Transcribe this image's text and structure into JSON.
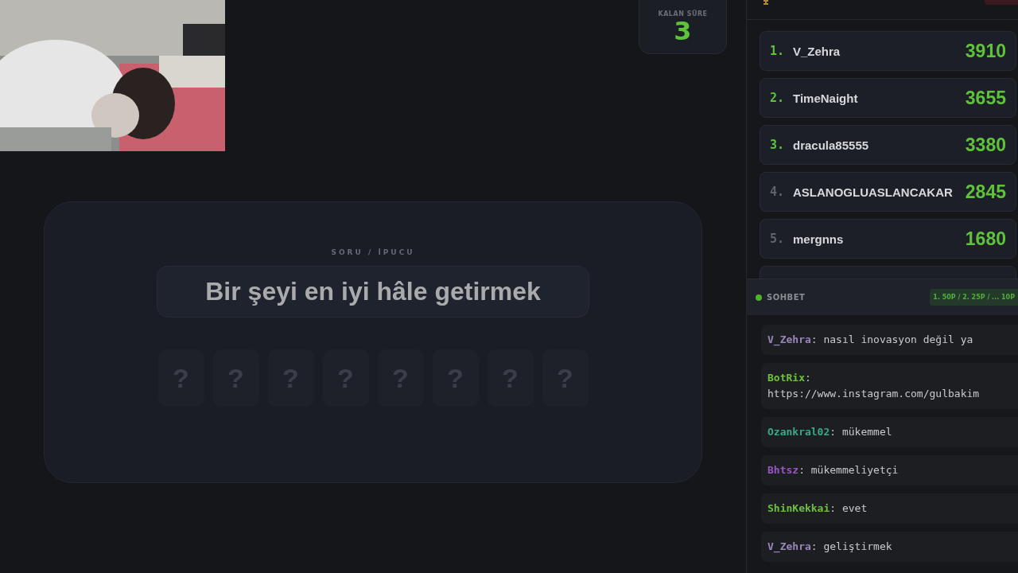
{
  "timer": {
    "label": "KALAN SÜRE",
    "value": "3"
  },
  "quiz": {
    "label": "SORU / İPUCU",
    "question": "Bir şeyi en iyi hâle getirmek",
    "tiles": [
      "?",
      "?",
      "?",
      "?",
      "?",
      "?",
      "?",
      "?"
    ]
  },
  "leaderboard": {
    "rows": [
      {
        "rank": "1.",
        "name": "V_Zehra",
        "score": "3910",
        "top": true
      },
      {
        "rank": "2.",
        "name": "TimeNaight",
        "score": "3655",
        "top": true
      },
      {
        "rank": "3.",
        "name": "dracula85555",
        "score": "3380",
        "top": true
      },
      {
        "rank": "4.",
        "name": "ASLANOGLUASLANCAKAR",
        "score": "2845",
        "top": false
      },
      {
        "rank": "5.",
        "name": "mergnns",
        "score": "1680",
        "top": false
      }
    ]
  },
  "chat": {
    "title": "SOHBET",
    "online": true,
    "rules": "1. 50P / 2. 25P / ... 10P",
    "messages": [
      {
        "user": "V_Zehra",
        "color": "#9a86b8",
        "sep": ":",
        "text": "nasıl inovasyon değil ya"
      },
      {
        "user": "BotRix",
        "color": "#6fc13a",
        "sep": ":",
        "text": "https://www.instagram.com/gulbakim"
      },
      {
        "user": "Ozankral02",
        "color": "#3aa987",
        "sep": ":",
        "text": "mükemmel"
      },
      {
        "user": "Bhtsz",
        "color": "#9656c4",
        "sep": ":",
        "text": "mükemmeliyetçi"
      },
      {
        "user": "ShinKekkai",
        "color": "#6fc13a",
        "sep": ":",
        "text": "evet"
      },
      {
        "user": "V_Zehra",
        "color": "#9a86b8",
        "sep": ":",
        "text": "geliştirmek"
      }
    ]
  }
}
